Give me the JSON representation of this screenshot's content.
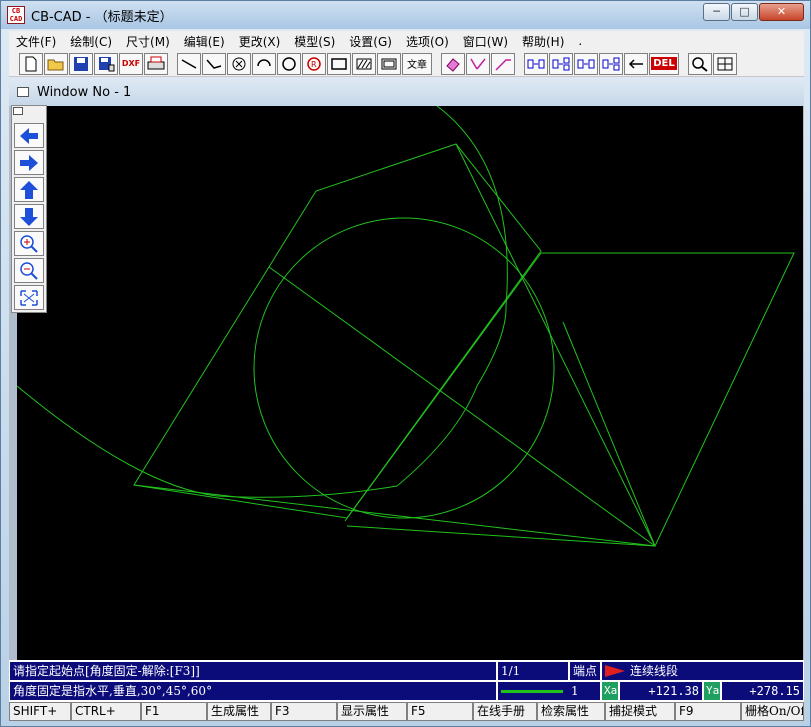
{
  "window": {
    "app_icon_text": "CB CAD",
    "title": "CB-CAD - （标题未定）",
    "controls": [
      "─",
      "□",
      "✕"
    ]
  },
  "menu": [
    "文件(F)",
    "绘制(C)",
    "尺寸(M)",
    "编辑(E)",
    "更改(X)",
    "模型(S)",
    "设置(G)",
    "选项(O)",
    "窗口(W)",
    "帮助(H)",
    "."
  ],
  "toolbar": {
    "dxf_label": "DXF",
    "text_label": "文章",
    "del_label": "DEL"
  },
  "child_window": {
    "title": "Window No - 1"
  },
  "status": {
    "prompt": "请指定起始点[角度固定-解除:[F3]]",
    "page": "1/1",
    "snap": "端点",
    "mode": "连续线段",
    "hint": "角度固定是指水平,垂直,30°,45°,60°",
    "line_width": "1",
    "xa_label": "Xa",
    "xa_value": "+121.38",
    "ya_label": "Ya",
    "ya_value": "+278.15"
  },
  "fkeys": [
    "SHIFT+",
    "CTRL+",
    "F1",
    "生成属性",
    "F3",
    "显示属性",
    "F5",
    "在线手册",
    "检索属性",
    "捕捉模式",
    "F9",
    "栅格On/Off"
  ],
  "colors": {
    "canvas": "#000000",
    "geometry": "#22c21e",
    "status_bg": "#0b0b7a",
    "mode_arrow": "#e02020"
  }
}
